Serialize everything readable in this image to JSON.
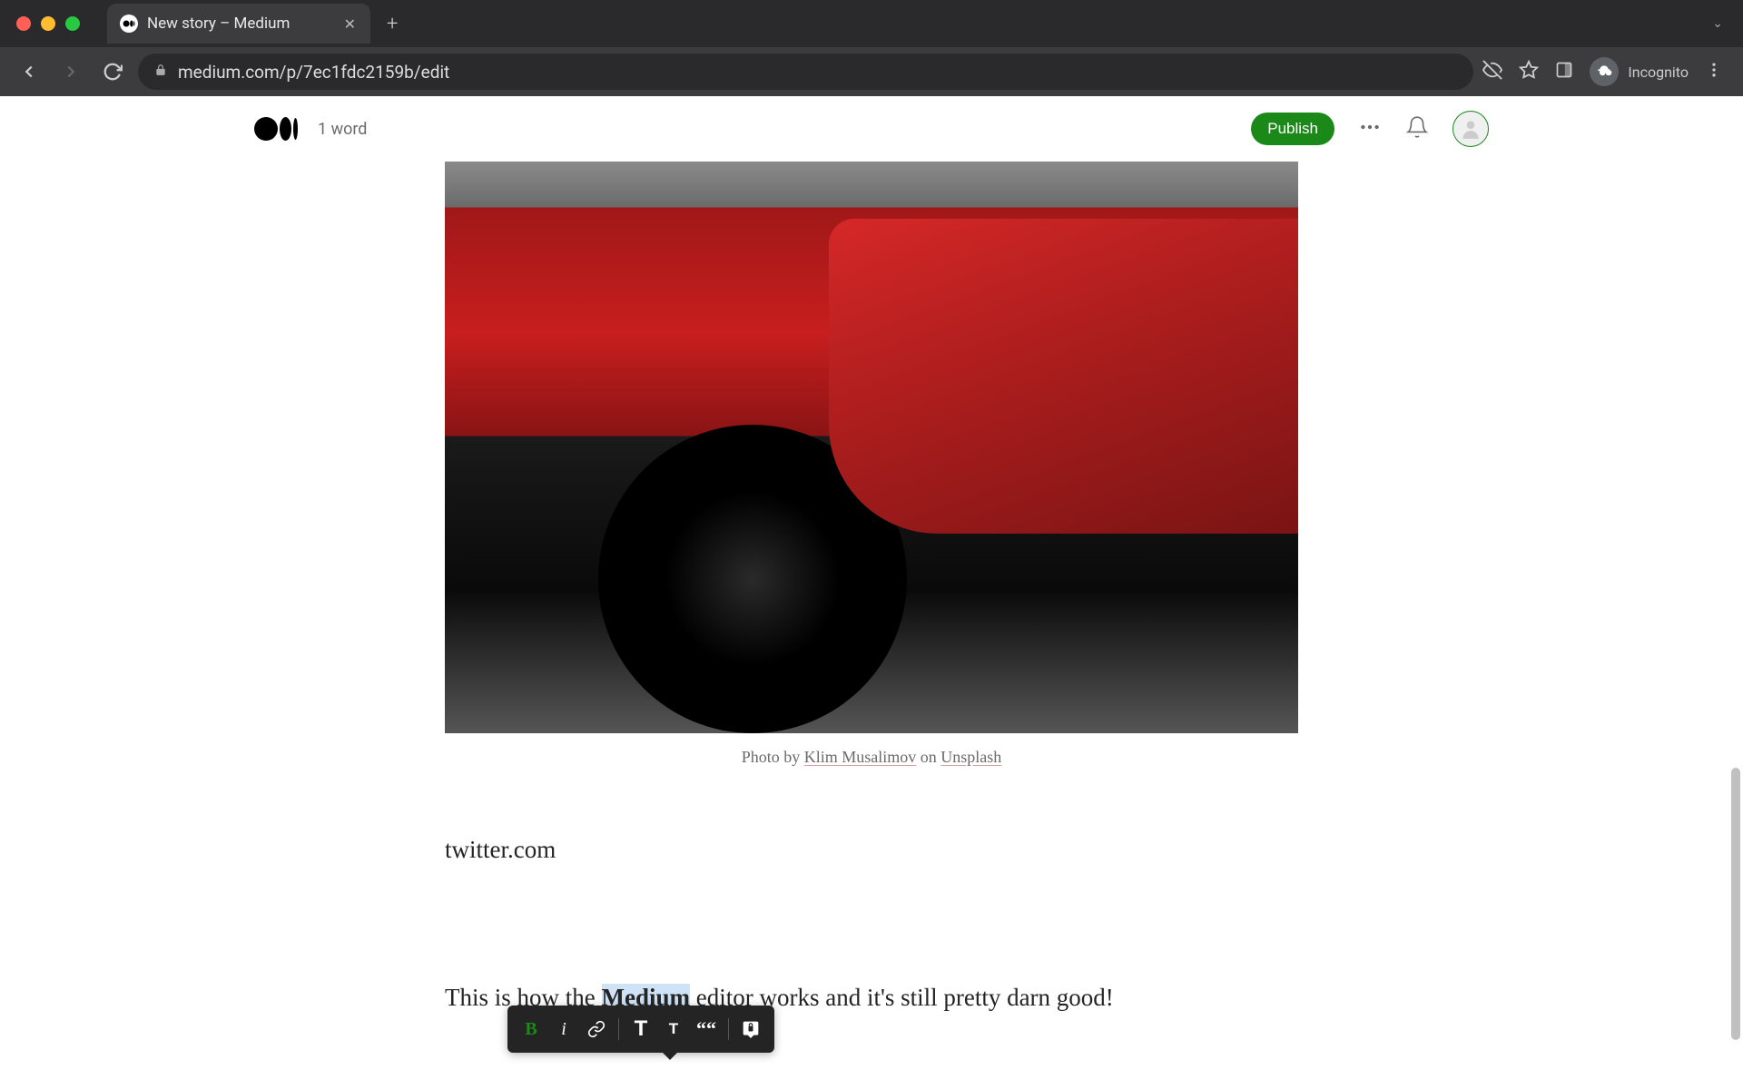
{
  "browser": {
    "tab_title": "New story – Medium",
    "url": "medium.com/p/7ec1fdc2159b/edit",
    "profile_label": "Incognito"
  },
  "header": {
    "word_count": "1 word",
    "publish_label": "Publish"
  },
  "image": {
    "caption_prefix": "Photo by ",
    "caption_author": "Klim Musalimov",
    "caption_middle": " on ",
    "caption_source": "Unsplash"
  },
  "content": {
    "line1": "twitter.com",
    "body_pre": "This is how the ",
    "body_highlight": "Medium",
    "body_post": " editor works and it's still pretty darn good!"
  },
  "toolbar": {
    "bold": "B",
    "italic": "i",
    "bigT": "T",
    "smallT": "T",
    "quote": "““"
  }
}
